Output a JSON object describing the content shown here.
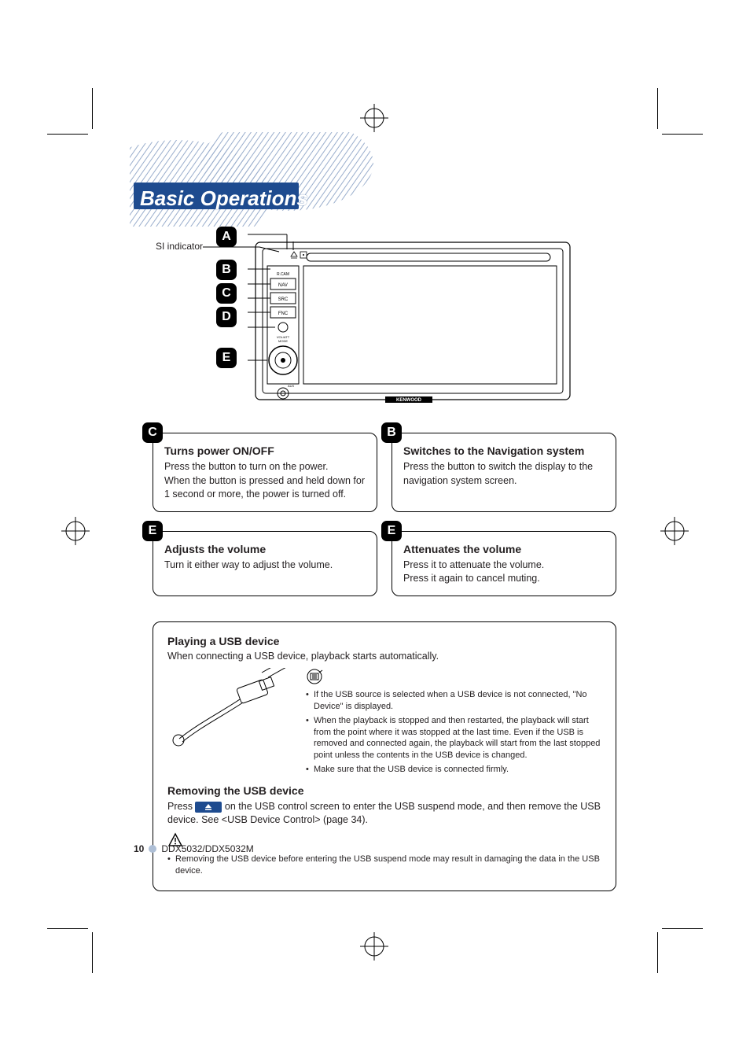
{
  "chapter_title": "Basic Operations",
  "si_indicator_label": "SI indicator",
  "diagram_letters": [
    "A",
    "B",
    "C",
    "D",
    "E"
  ],
  "panel_labels": {
    "nav": "NAV",
    "src": "SRC",
    "fnc": "FNC",
    "brand": "KENWOOD"
  },
  "box_power": {
    "letter": "C",
    "title": "Turns power ON/OFF",
    "lines": [
      "Press the button to turn on the power.",
      "When the button is pressed and held down for 1 second or more, the power is turned off."
    ]
  },
  "box_nav": {
    "letter": "B",
    "title": "Switches to the Navigation system",
    "lines": [
      "Press the button to switch the display to the navigation system screen."
    ]
  },
  "box_vol": {
    "letter": "E",
    "title": "Adjusts the volume",
    "lines": [
      "Turn it either way to adjust the volume."
    ]
  },
  "box_att": {
    "letter": "E",
    "title": "Attenuates the volume",
    "lines": [
      "Press it to attenuate the volume.",
      "Press it again to cancel muting."
    ]
  },
  "usb": {
    "title_play": "Playing a USB device",
    "lead": "When connecting a USB device, playback starts automatically.",
    "notes": [
      "If the USB source is selected when a USB device is not connected, \"No Device\" is displayed.",
      "When the playback is stopped and then restarted, the playback will start from the point where it was stopped at the last time. Even if the USB is removed and connected again, the playback will start from the last stopped point unless the contents in the USB device is changed.",
      "Make sure that the USB device is connected firmly."
    ],
    "title_remove": "Removing the USB device",
    "remove_pre": "Press ",
    "remove_post": " on the USB control screen to enter the USB suspend mode, and then remove the USB device. See <USB Device Control> (page 34).",
    "caution": "Removing the USB device before entering the USB suspend mode may result in damaging the data in the USB device."
  },
  "footer": {
    "page": "10",
    "model": "DDX5032/DDX5032M"
  }
}
